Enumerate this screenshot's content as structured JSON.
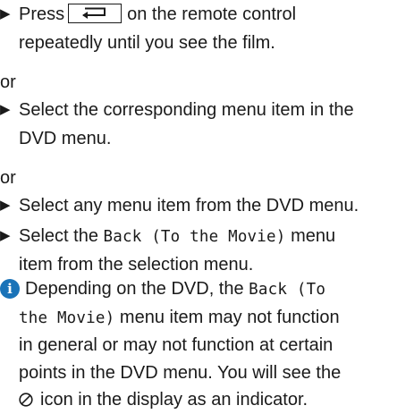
{
  "step1": {
    "before_key": "Press",
    "key_icon": "back-arrow-icon",
    "after_key": "on the remote control",
    "line2": "repeatedly until you see the film."
  },
  "or_1": "or",
  "step2": {
    "line1": "Select the corresponding menu item in the",
    "line2": "DVD menu."
  },
  "or_2": "or",
  "step3": {
    "line1": "Select any menu item from the DVD menu."
  },
  "step4": {
    "line1_prefix": "Select the",
    "line1_mono": "Back (To the Movie)",
    "line1_suffix": "menu",
    "line2": "item from the selection menu."
  },
  "note": {
    "icon": "info-icon",
    "icon_color": "#1a73b8",
    "line1_prefix": "Depending on the DVD, the",
    "line1_mono": "Back (To",
    "line2_mono": "the Movie)",
    "line2_suffix": "menu item may not function",
    "line3": "in general or may not function at certain",
    "line4": "points in the DVD menu. You will see the",
    "line5_icon": "prohibited-icon",
    "line5": "icon in the display as an indicator."
  }
}
